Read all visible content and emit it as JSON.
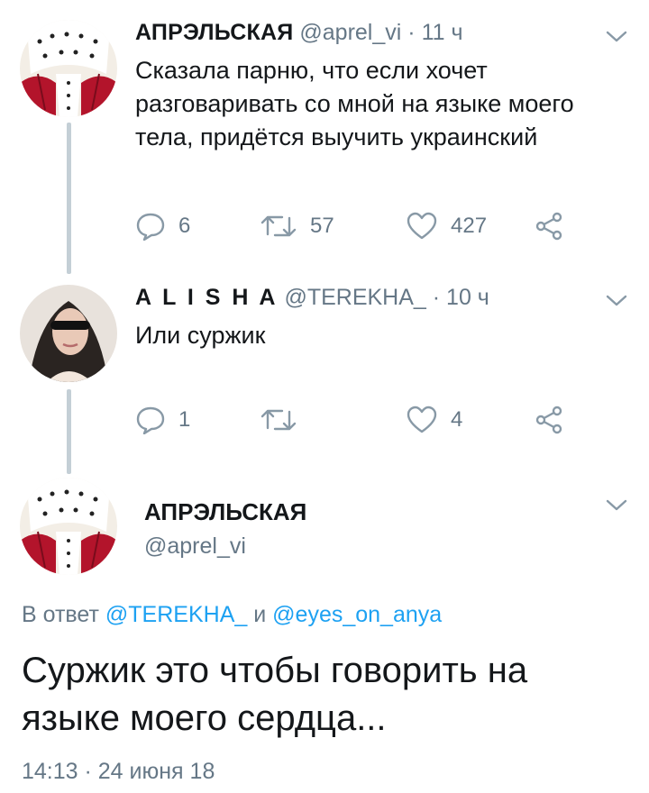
{
  "tweets": [
    {
      "display_name": "АПРЭЛЬСКАЯ",
      "handle": "@aprel_vi",
      "separator": "·",
      "time": "11 ч",
      "text": "Сказала парню, что если хочет разговаривать со мной на языке моего тела, придётся выучить украинский",
      "replies": "6",
      "retweets": "57",
      "likes": "427"
    },
    {
      "display_name": "A L I S H A",
      "handle": "@TEREKHA_",
      "separator": "·",
      "time": "10 ч",
      "text": "Или суржик",
      "replies": "1",
      "retweets": "",
      "likes": "4"
    }
  ],
  "main_tweet": {
    "display_name": "АПРЭЛЬСКАЯ",
    "handle": "@aprel_vi",
    "reply_prefix": "В ответ",
    "reply_mention_1": "@TEREKHA_",
    "reply_and": "и",
    "reply_mention_2": "@eyes_on_anya",
    "text": "Суржик это чтобы говорить на языке моего сердца...",
    "timestamp": "14:13 · 24 июня 18"
  },
  "icons": {
    "reply": "reply-icon",
    "retweet": "retweet-icon",
    "like": "heart-icon",
    "share": "share-icon",
    "menu": "chevron-down-icon"
  },
  "colors": {
    "text": "#14171a",
    "secondary": "#657786",
    "mention": "#1da1f2",
    "icon": "#8899a6",
    "thread_line": "#c4cfd6"
  }
}
